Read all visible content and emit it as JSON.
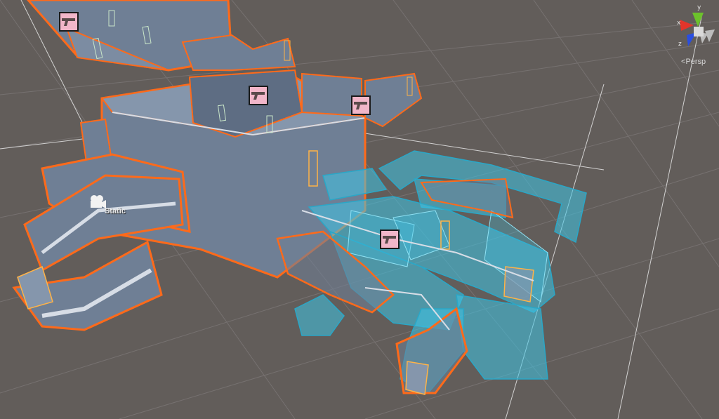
{
  "viewport": {
    "camera_label": "Static",
    "projection_label": "Persp",
    "axes": {
      "x": "x",
      "y": "y",
      "z": "z"
    }
  },
  "colors": {
    "background": "#625d5a",
    "grid": "#767170",
    "wall": "#6f7f95",
    "selection_outline": "#ff6a1a",
    "transparent_geometry": "#3ec4e6",
    "gun_icon_bg": "#f2b6c9",
    "axis_x": "#e3352b",
    "axis_y": "#6cc22b",
    "axis_z": "#2a4ee0"
  },
  "icons": {
    "weapon_pickup": "pistol-icon",
    "camera": "camera-icon",
    "orientation": "scene-gizmo-icon"
  },
  "weapon_pickup_count": 4
}
